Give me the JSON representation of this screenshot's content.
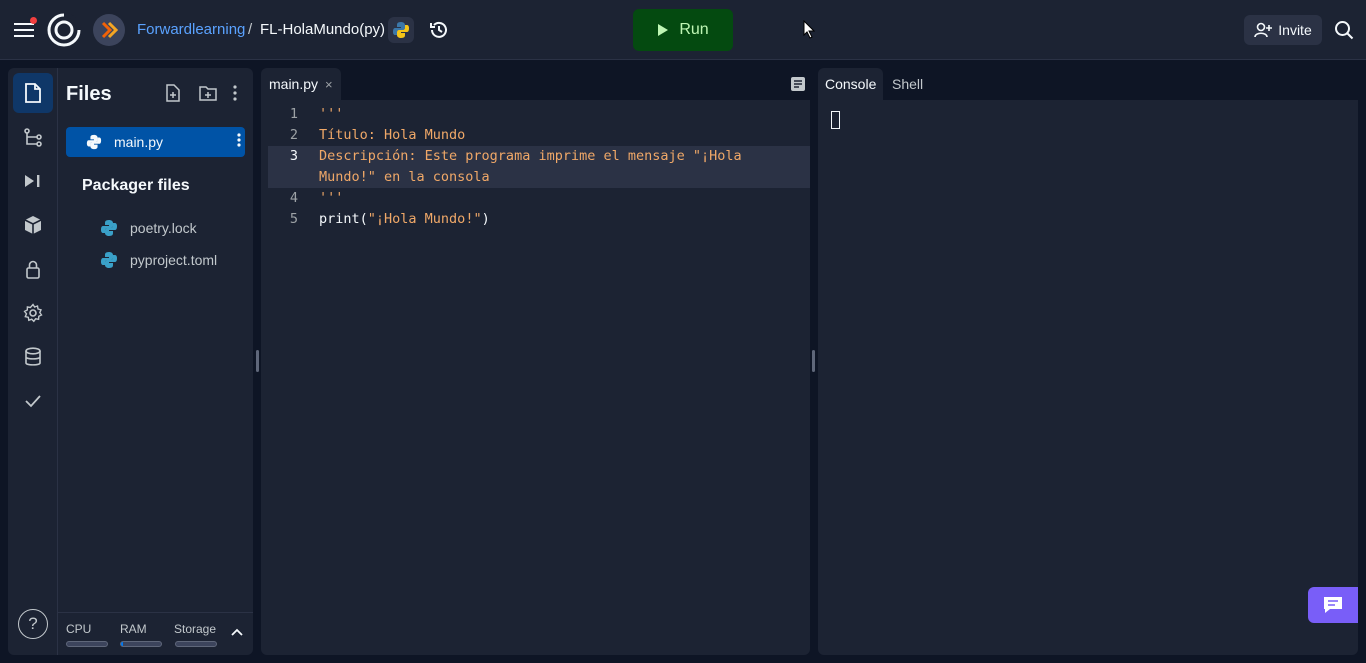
{
  "topbar": {
    "owner": "Forwardlearning",
    "separator": "/",
    "repl_name": "FL-HolaMundo(py)",
    "run_label": "Run",
    "invite_label": "Invite"
  },
  "files_panel": {
    "title": "Files",
    "active_file": "main.py",
    "packager_title": "Packager files",
    "packager_files": [
      "poetry.lock",
      "pyproject.toml"
    ]
  },
  "resources": {
    "labels": [
      "CPU",
      "RAM",
      "Storage"
    ],
    "usage": [
      0.0,
      0.05,
      0.0
    ]
  },
  "editor": {
    "tab_label": "main.py",
    "tab_close": "×",
    "lines": [
      {
        "num": "1",
        "text": "'''"
      },
      {
        "num": "2",
        "text": "Título: Hola Mundo"
      },
      {
        "num": "3",
        "text": "Descripción: Este programa imprime el mensaje \"¡Hola Mundo!\" en la consola"
      },
      {
        "num": "4",
        "text": "'''"
      },
      {
        "num": "5",
        "text": "print(\"¡Hola Mundo!\")",
        "parts": [
          "print(",
          "\"¡Hola Mundo!\"",
          ")"
        ]
      }
    ],
    "active_line": 3
  },
  "console": {
    "tabs": [
      "Console",
      "Shell"
    ]
  },
  "help_label": "?",
  "colors": {
    "accent": "#0079f2",
    "run_bg": "#044a10",
    "string": "#f0a868",
    "chat": "#795ef8",
    "notification": "#f23f3f"
  }
}
